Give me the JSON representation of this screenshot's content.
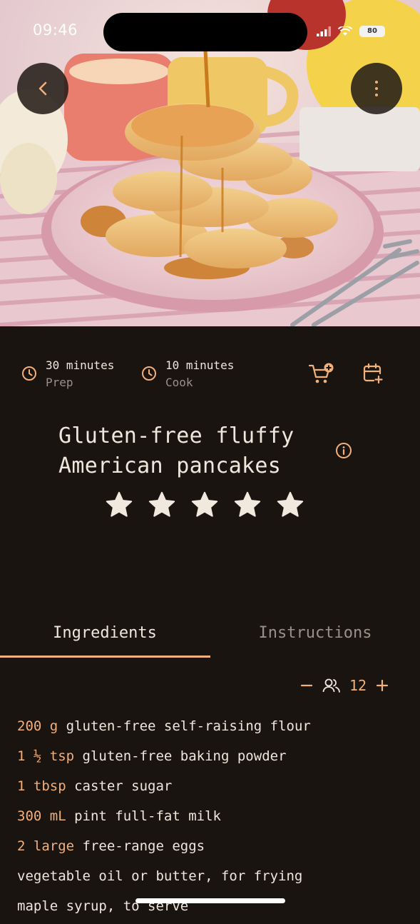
{
  "status_bar": {
    "time": "09:46",
    "battery": "80"
  },
  "header": {
    "back_icon": "chevron-left-icon",
    "more_icon": "more-vertical-icon"
  },
  "meta": {
    "prep": {
      "value": "30 minutes",
      "label": "Prep"
    },
    "cook": {
      "value": "10 minutes",
      "label": "Cook"
    },
    "cart_icon": "cart-add-icon",
    "calendar_icon": "calendar-add-icon"
  },
  "recipe": {
    "title_line1": "Gluten-free fluffy",
    "title_line2": "American pancakes",
    "rating": 5,
    "rating_max": 5
  },
  "tabs": [
    {
      "label": "Ingredients",
      "active": true
    },
    {
      "label": "Instructions",
      "active": false
    }
  ],
  "servings": {
    "count": "12"
  },
  "ingredients": [
    {
      "qty": "200 g",
      "text": "gluten-free self-raising flour"
    },
    {
      "qty": "1 ½ tsp",
      "text": "gluten-free baking powder"
    },
    {
      "qty": "1 tbsp",
      "text": "caster sugar"
    },
    {
      "qty": "300 mL",
      "text": "pint full-fat milk"
    },
    {
      "qty": "2 large",
      "text": "free-range eggs"
    },
    {
      "qty": "",
      "text": "vegetable oil or butter, for frying"
    },
    {
      "qty": "",
      "text": "maple syrup, to serve"
    }
  ],
  "colors": {
    "accent": "#f2b07a",
    "background": "#1a1411",
    "text": "#efe6dc",
    "muted": "#9a9088"
  }
}
